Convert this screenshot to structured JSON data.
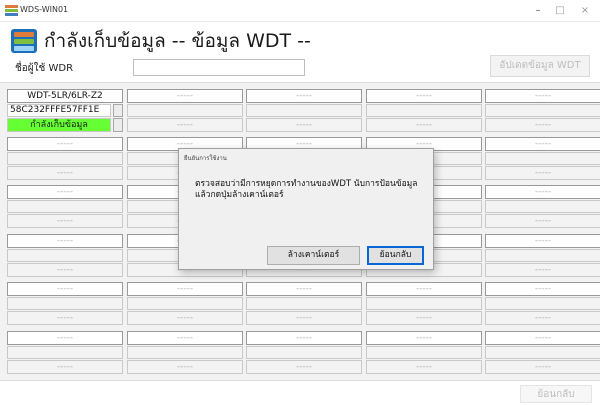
{
  "window": {
    "title": "WDS-WIN01",
    "minimize_glyph": "–",
    "maximize_glyph": "□",
    "close_glyph": "×"
  },
  "header": {
    "title": "กำลังเก็บข้อมูล -- ข้อมูล WDT --",
    "user_label": "ชื่อผู้ใช้ WDR",
    "user_value": "",
    "upload_button": "อัปเดตข้อมูล WDT"
  },
  "grid": {
    "placeholder": "-----",
    "cells": [
      {
        "name": "WDT-5LR/6LR-Z2",
        "id": "58C232FFFE57FF1E",
        "status": "กำลังเก็บข้อมูล",
        "active": true
      },
      {
        "name": "-----",
        "id": "",
        "status": "-----",
        "active": false
      },
      {
        "name": "-----",
        "id": "",
        "status": "-----",
        "active": false
      },
      {
        "name": "-----",
        "id": "",
        "status": "-----",
        "active": false
      },
      {
        "name": "-----",
        "id": "",
        "status": "-----",
        "active": false
      },
      {
        "name": "-----",
        "id": "",
        "status": "-----",
        "active": false
      },
      {
        "name": "-----",
        "id": "",
        "status": "-----",
        "active": false
      },
      {
        "name": "-----",
        "id": "",
        "status": "-----",
        "active": false
      },
      {
        "name": "-----",
        "id": "",
        "status": "-----",
        "active": false
      },
      {
        "name": "-----",
        "id": "",
        "status": "-----",
        "active": false
      },
      {
        "name": "-----",
        "id": "",
        "status": "-----",
        "active": false
      },
      {
        "name": "-----",
        "id": "",
        "status": "-----",
        "active": false
      },
      {
        "name": "-----",
        "id": "",
        "status": "-----",
        "active": false
      },
      {
        "name": "-----",
        "id": "",
        "status": "-----",
        "active": false
      },
      {
        "name": "-----",
        "id": "",
        "status": "-----",
        "active": false
      },
      {
        "name": "-----",
        "id": "",
        "status": "-----",
        "active": false
      },
      {
        "name": "-----",
        "id": "",
        "status": "-----",
        "active": false
      },
      {
        "name": "-----",
        "id": "",
        "status": "-----",
        "active": false
      },
      {
        "name": "-----",
        "id": "",
        "status": "-----",
        "active": false
      },
      {
        "name": "-----",
        "id": "",
        "status": "-----",
        "active": false
      },
      {
        "name": "-----",
        "id": "",
        "status": "-----",
        "active": false
      },
      {
        "name": "-----",
        "id": "",
        "status": "-----",
        "active": false
      },
      {
        "name": "-----",
        "id": "",
        "status": "-----",
        "active": false
      },
      {
        "name": "-----",
        "id": "",
        "status": "-----",
        "active": false
      },
      {
        "name": "-----",
        "id": "",
        "status": "-----",
        "active": false
      },
      {
        "name": "-----",
        "id": "",
        "status": "-----",
        "active": false
      },
      {
        "name": "-----",
        "id": "",
        "status": "-----",
        "active": false
      },
      {
        "name": "-----",
        "id": "",
        "status": "-----",
        "active": false
      },
      {
        "name": "-----",
        "id": "",
        "status": "-----",
        "active": false
      },
      {
        "name": "-----",
        "id": "",
        "status": "-----",
        "active": false
      }
    ]
  },
  "footer": {
    "back_button": "ย้อนกลับ"
  },
  "dialog": {
    "title": "ยืนยันการใช้งาน",
    "message": "ตรวจสอบว่ามีการหยุดการทำงานของWDT นับการป้อนข้อมูลแล้วกดปุ่มล้างเคาน์เตอร์",
    "clear_button": "ล้างเคาน์เตอร์",
    "back_button": "ย้อนกลับ"
  },
  "colors": {
    "status_active": "#66ff33",
    "focus_border": "#0a66d6"
  },
  "icons": {
    "app": "app-logo-icon",
    "header": "database-logo-icon"
  }
}
